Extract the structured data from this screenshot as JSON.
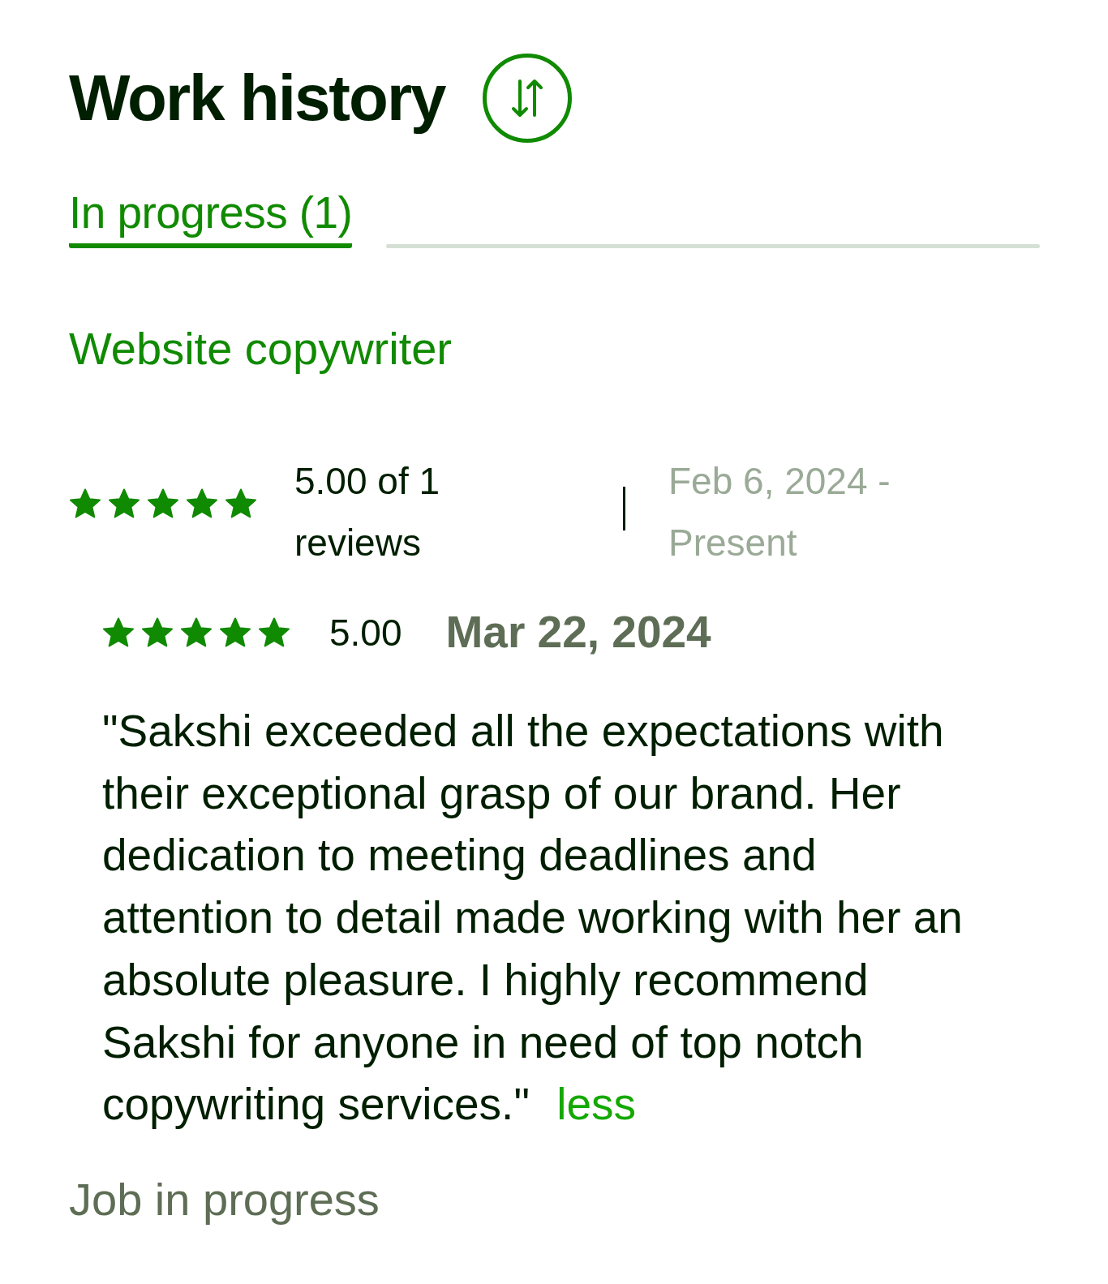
{
  "heading": {
    "title": "Work history"
  },
  "tabs": [
    {
      "label": "In progress (1)",
      "selected": true
    }
  ],
  "jobs": [
    {
      "title": "Website copywriter",
      "stars": 5,
      "rating": "5.00 of 1 reviews",
      "period": "Feb 6, 2024 - Present",
      "review": {
        "stars": 5,
        "score": "5.00",
        "date": "Mar 22, 2024",
        "text": "\"Sakshi exceeded all the expectations with their exceptional grasp of our brand. Her dedication to meeting deadlines and attention to detail made working with her an absolute pleasure. I highly recommend Sakshi for anyone in need of top notch copywriting services.\"",
        "toggle": "less"
      },
      "status": "Job in progress"
    }
  ]
}
